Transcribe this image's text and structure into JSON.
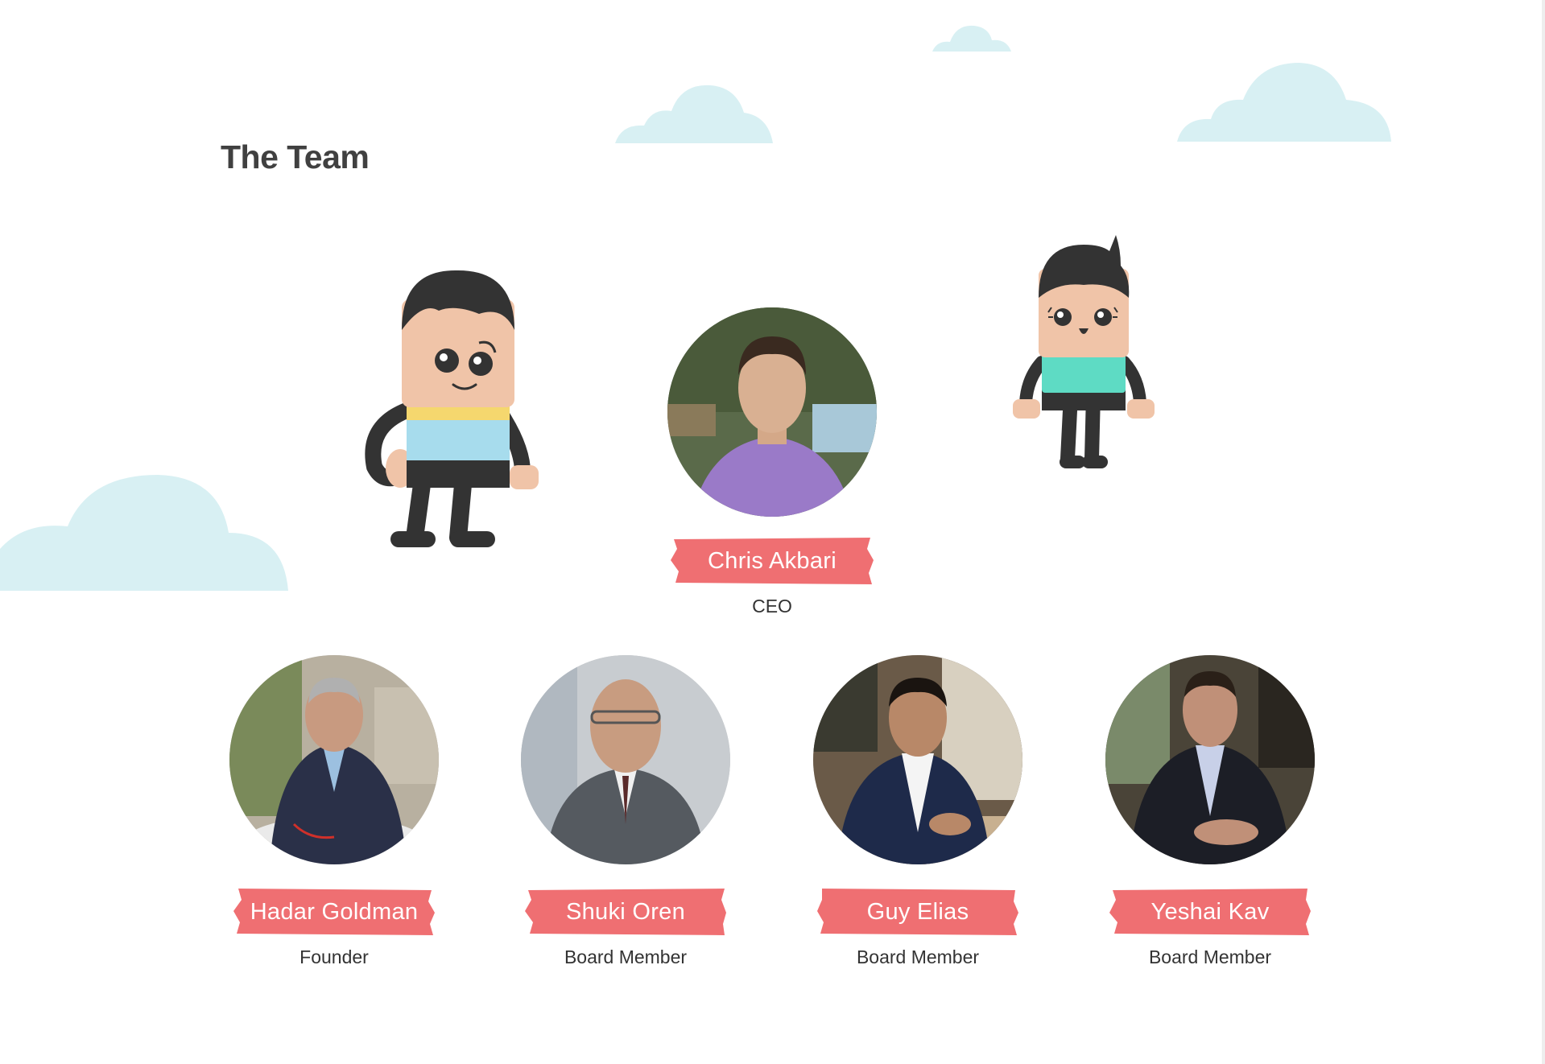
{
  "page": {
    "title": "The Team"
  },
  "colors": {
    "accent": "#ef6f72",
    "cloud": "#d8f0f3",
    "title": "#404040",
    "role_text": "#333333"
  },
  "mascots": [
    {
      "icon": "mascot-character-blue-shirt"
    },
    {
      "icon": "mascot-character-green-shirt"
    }
  ],
  "ceo": {
    "name": "Chris Akbari",
    "role": "CEO",
    "icon": "portrait-photo"
  },
  "members": [
    {
      "name": "Hadar Goldman",
      "role": "Founder",
      "icon": "portrait-photo"
    },
    {
      "name": "Shuki Oren",
      "role": "Board Member",
      "icon": "portrait-photo"
    },
    {
      "name": "Guy Elias",
      "role": "Board Member",
      "icon": "portrait-photo"
    },
    {
      "name": "Yeshai Kav",
      "role": "Board Member",
      "icon": "portrait-photo"
    }
  ]
}
